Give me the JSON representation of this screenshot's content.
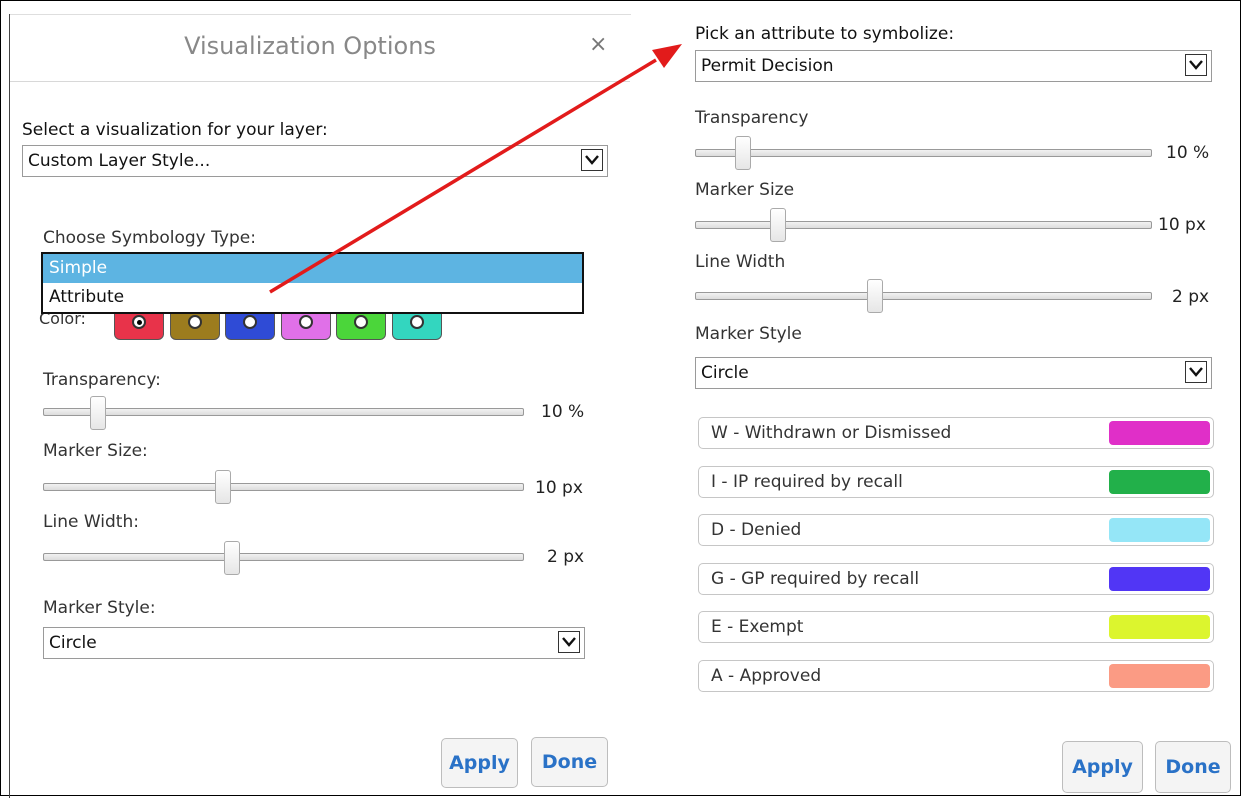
{
  "left_panel": {
    "title": "Visualization Options",
    "close_glyph": "×",
    "visualization_label": "Select a visualization for your layer:",
    "visualization_value": "Custom Layer Style...",
    "symbology_label": "Choose Symbology Type:",
    "symbology_options": [
      {
        "label": "Simple",
        "selected": true
      },
      {
        "label": "Attribute",
        "selected": false
      }
    ],
    "color_label": "Color:",
    "colors": [
      "#e8334a",
      "#9c7c1e",
      "#2f4bd6",
      "#e070e8",
      "#4bd63a",
      "#33d6bf"
    ],
    "transparency": {
      "label": "Transparency:",
      "value": "10 %",
      "level_percent": 10
    },
    "marker_size": {
      "label": "Marker Size:",
      "value": "10 px",
      "level_percent": 37
    },
    "line_width": {
      "label": "Line Width:",
      "value": "2 px",
      "level_percent": 39
    },
    "marker_style": {
      "label": "Marker Style:",
      "value": "Circle"
    },
    "apply_label": "Apply",
    "done_label": "Done"
  },
  "right_panel": {
    "attribute_label": "Pick an attribute to symbolize:",
    "attribute_value": "Permit Decision",
    "transparency": {
      "label": "Transparency",
      "value": "10 %",
      "level_percent": 9
    },
    "marker_size": {
      "label": "Marker Size",
      "value": "10 px",
      "level_percent": 17
    },
    "line_width": {
      "label": "Line Width",
      "value": "2 px",
      "level_percent": 39
    },
    "marker_style": {
      "label": "Marker Style",
      "value": "Circle"
    },
    "legend": [
      {
        "label": "W - Withdrawn or Dismissed",
        "color": "#e02fc8"
      },
      {
        "label": "I - IP required by recall",
        "color": "#22b04a"
      },
      {
        "label": "D - Denied",
        "color": "#95e6f7"
      },
      {
        "label": "G - GP required by recall",
        "color": "#5136f5"
      },
      {
        "label": "E - Exempt",
        "color": "#dcf52e"
      },
      {
        "label": "A - Approved",
        "color": "#fb9b84"
      }
    ],
    "apply_label": "Apply",
    "done_label": "Done"
  },
  "annotation": {
    "arrow_color": "#e21b1b"
  }
}
